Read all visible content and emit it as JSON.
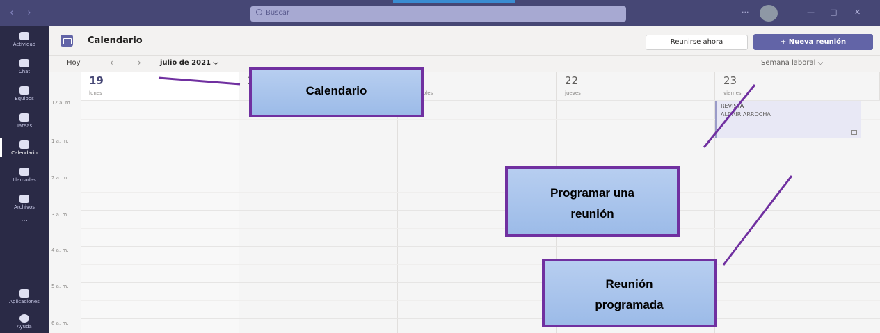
{
  "titlebar": {
    "nav": "‹ ›",
    "search_placeholder": "Buscar",
    "controls": [
      "···",
      "—",
      "□",
      "✕"
    ]
  },
  "rail": [
    {
      "label": "Actividad",
      "icon": "bell-icon"
    },
    {
      "label": "Chat",
      "icon": "chat-icon"
    },
    {
      "label": "Equipos",
      "icon": "teams-icon"
    },
    {
      "label": "Tareas",
      "icon": "tasks-icon"
    },
    {
      "label": "Calendario",
      "icon": "calendar-icon",
      "active": true
    },
    {
      "label": "Llamadas",
      "icon": "phone-icon"
    },
    {
      "label": "Archivos",
      "icon": "files-icon"
    },
    {
      "label": "···",
      "icon": "more-icon"
    },
    {
      "label": "Aplicaciones",
      "icon": "apps-icon"
    },
    {
      "label": "Ayuda",
      "icon": "help-icon"
    }
  ],
  "header": {
    "title": "Calendario",
    "meet_now": "Reunirse ahora",
    "new_meeting": "+ Nueva reunión"
  },
  "toolbar": {
    "today": "Hoy",
    "month": "julio de 2021 ⌵",
    "view": "Semana laboral ⌵"
  },
  "days": [
    {
      "num": "19",
      "name": "lunes",
      "today": true
    },
    {
      "num": "2",
      "name": ""
    },
    {
      "num": "",
      "name": "oles"
    },
    {
      "num": "22",
      "name": "jueves"
    },
    {
      "num": "23",
      "name": "viernes"
    }
  ],
  "times": [
    "12 a. m.",
    "1 a. m.",
    "2 a. m.",
    "3 a. m.",
    "4 a. m.",
    "5 a. m.",
    "6 a. m."
  ],
  "event": {
    "title": "REVISTA",
    "organizer": "ALDAIR ARROCHA"
  },
  "callouts": {
    "calendario": "Calendario",
    "programar": [
      "Programar una",
      "reunión"
    ],
    "programada": [
      "Reunión",
      "programada"
    ]
  },
  "colors": {
    "accent": "#6264a7",
    "callout_border": "#7030a0"
  }
}
